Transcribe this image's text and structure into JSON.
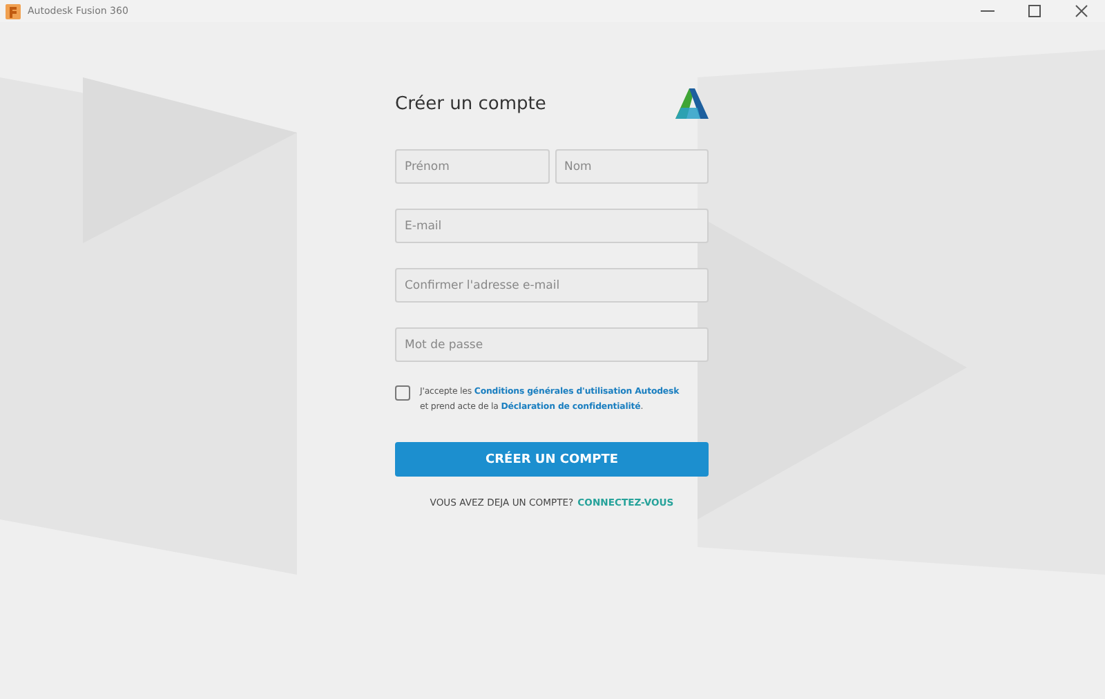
{
  "window": {
    "title": "Autodesk Fusion 360"
  },
  "form": {
    "title": "Créer un compte",
    "name_fields": [
      {
        "placeholder": "Prénom"
      },
      {
        "placeholder": "Nom"
      }
    ],
    "fields": [
      {
        "placeholder": "E-mail"
      },
      {
        "placeholder": "Confirmer l'adresse e-mail"
      },
      {
        "placeholder": "Mot de passe"
      }
    ],
    "consent": {
      "checked": false,
      "text_1": "J'accepte les",
      "link_1": "Conditions générales d'utilisation Autodesk",
      "text_2": "et prend acte de la",
      "link_2": "Déclaration de confidentialité",
      "text_3": "."
    },
    "submit": "CRÉER UN COMPTE",
    "signin": {
      "text": "VOUS AVEZ DEJA UN COMPTE?",
      "link": "CONNECTEZ-VOUS"
    }
  }
}
